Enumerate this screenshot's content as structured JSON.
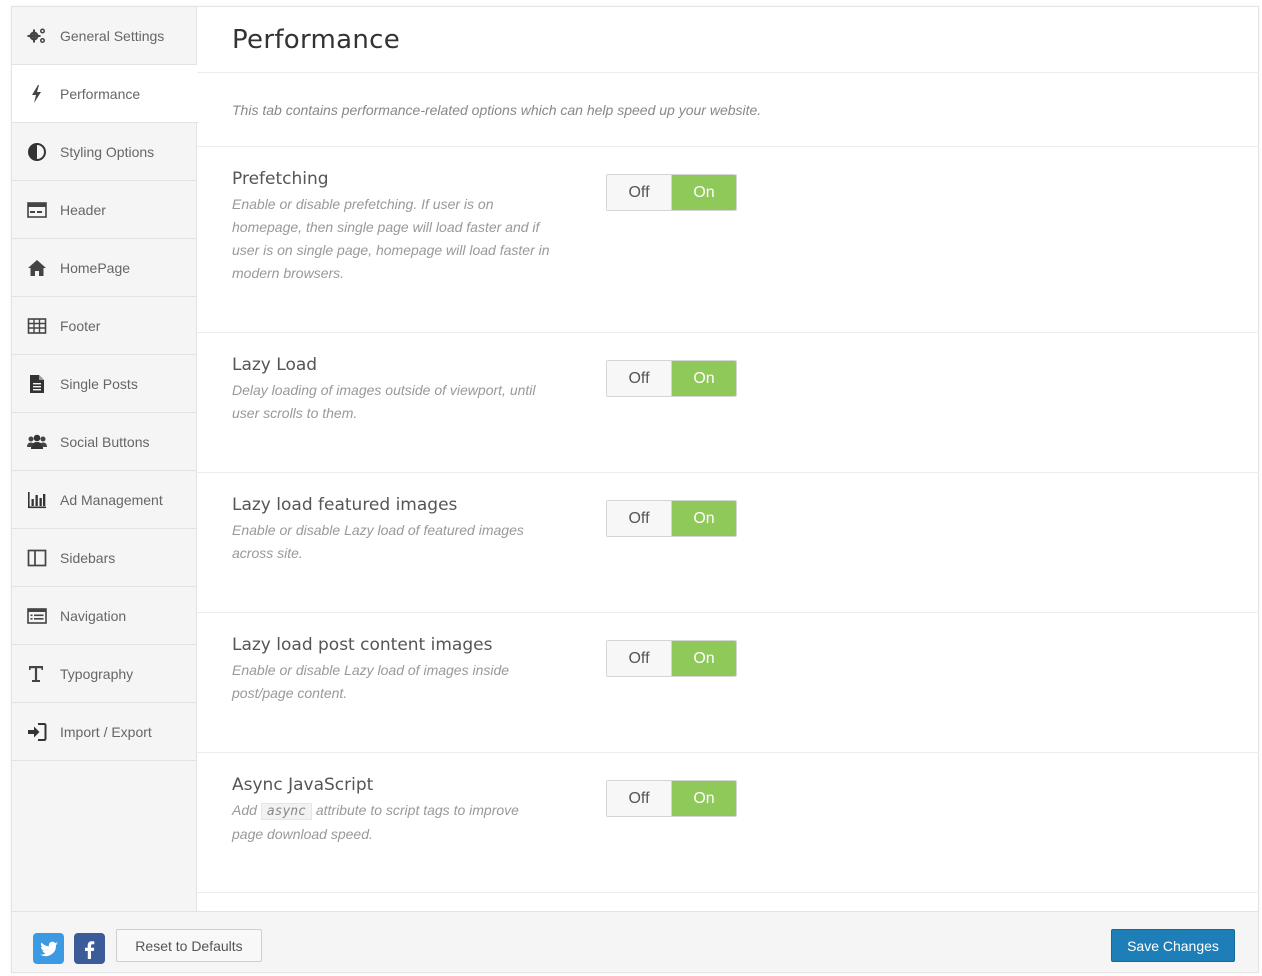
{
  "sidebar": {
    "items": [
      {
        "label": "General Settings",
        "icon": "gears-icon"
      },
      {
        "label": "Performance",
        "icon": "bolt-icon"
      },
      {
        "label": "Styling Options",
        "icon": "contrast-icon"
      },
      {
        "label": "Header",
        "icon": "header-layout-icon"
      },
      {
        "label": "HomePage",
        "icon": "home-icon"
      },
      {
        "label": "Footer",
        "icon": "table-icon"
      },
      {
        "label": "Single Posts",
        "icon": "document-icon"
      },
      {
        "label": "Social Buttons",
        "icon": "users-icon"
      },
      {
        "label": "Ad Management",
        "icon": "bar-chart-icon"
      },
      {
        "label": "Sidebars",
        "icon": "columns-icon"
      },
      {
        "label": "Navigation",
        "icon": "list-alt-icon"
      },
      {
        "label": "Typography",
        "icon": "text-height-icon"
      },
      {
        "label": "Import / Export",
        "icon": "sign-in-icon"
      }
    ],
    "active": "Performance"
  },
  "main": {
    "title": "Performance",
    "intro": "This tab contains performance-related options which can help speed up your website.",
    "options": [
      {
        "title": "Prefetching",
        "desc": "Enable or disable prefetching. If user is on homepage, then single page will load faster and if user is on single page, homepage will load faster in modern browsers.",
        "off_label": "Off",
        "on_label": "On",
        "value": "On"
      },
      {
        "title": "Lazy Load",
        "desc": "Delay loading of images outside of viewport, until user scrolls to them.",
        "off_label": "Off",
        "on_label": "On",
        "value": "On"
      },
      {
        "title": "Lazy load featured images",
        "desc": "Enable or disable Lazy load of featured images across site.",
        "off_label": "Off",
        "on_label": "On",
        "value": "On"
      },
      {
        "title": "Lazy load post content images",
        "desc": "Enable or disable Lazy load of images inside post/page content.",
        "off_label": "Off",
        "on_label": "On",
        "value": "On"
      },
      {
        "title": "Async JavaScript",
        "desc_before": "Add",
        "desc_code": "async",
        "desc_after": "attribute to script tags to improve page download speed.",
        "off_label": "Off",
        "on_label": "On",
        "value": "On"
      }
    ]
  },
  "footer": {
    "social": [
      "twitter-icon",
      "facebook-icon"
    ],
    "reset_label": "Reset to Defaults",
    "save_label": "Save Changes"
  },
  "colors": {
    "toggle_on": "#8fc95a",
    "save_button": "#1e7fb8",
    "twitter": "#3b9ae1",
    "facebook": "#3c5c99"
  }
}
